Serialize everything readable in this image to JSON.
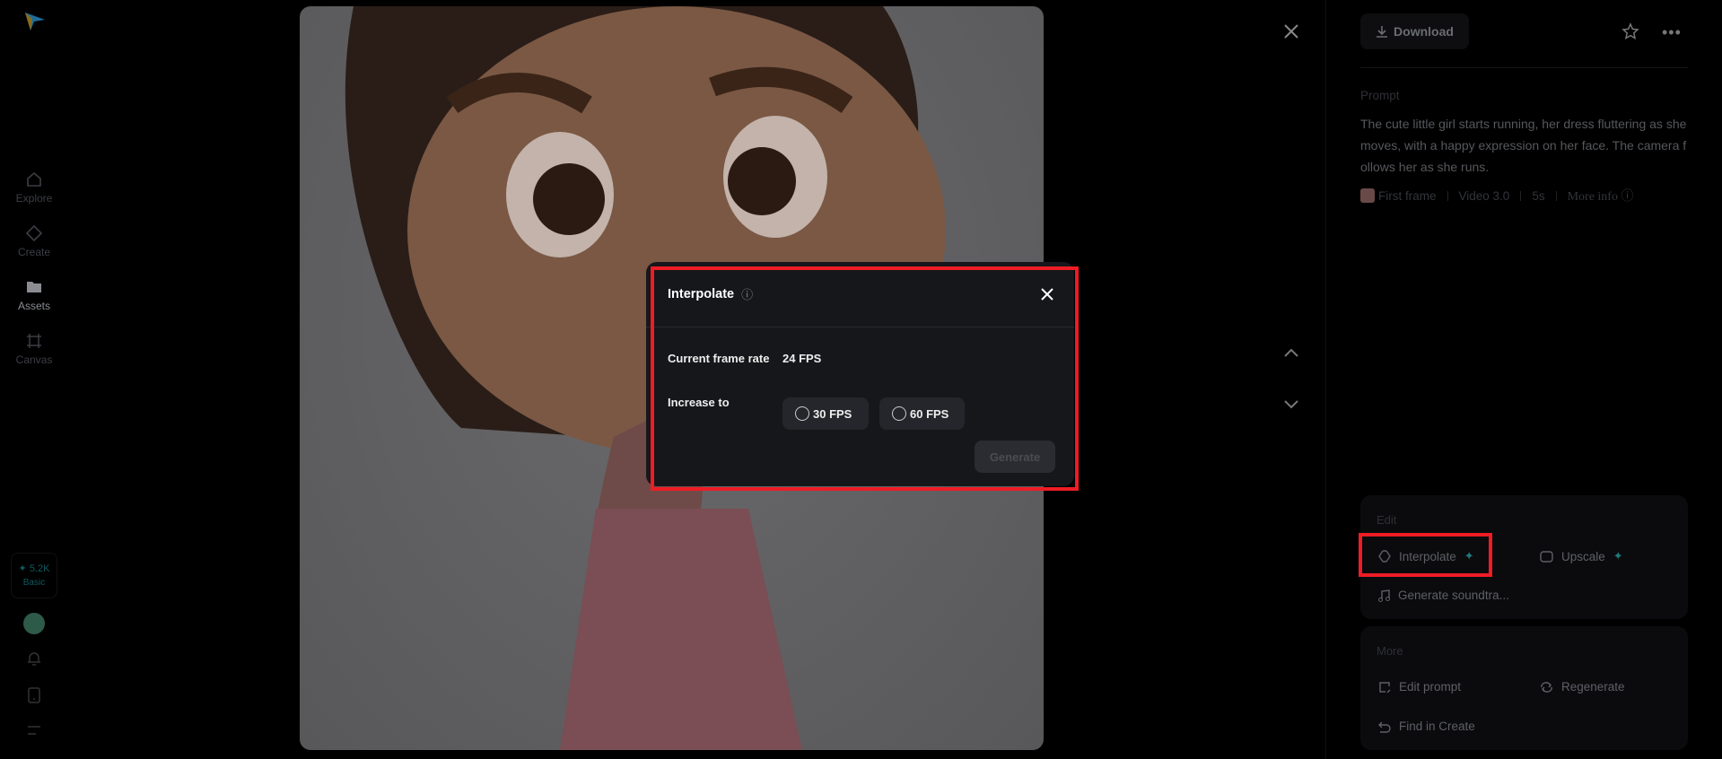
{
  "sidebar": {
    "items": [
      {
        "label": "Explore",
        "icon": "home-icon"
      },
      {
        "label": "Create",
        "icon": "diamond-icon"
      },
      {
        "label": "Assets",
        "icon": "folder-icon",
        "active": true
      },
      {
        "label": "Canvas",
        "icon": "crop-icon"
      }
    ],
    "credits": {
      "amount": "5.2K",
      "plan": "Basic"
    }
  },
  "header": {
    "download_label": "Download"
  },
  "prompt": {
    "label": "Prompt",
    "text": "The cute little girl starts running, her dress fluttering as she moves, with a happy expression on her face. The camera follows her as she runs.",
    "meta": {
      "reference": "First frame",
      "model": "Video 3.0",
      "duration": "5s",
      "more_info": "More info"
    }
  },
  "edit": {
    "label": "Edit",
    "interpolate": "Interpolate",
    "upscale": "Upscale",
    "soundtrack": "Generate soundtra..."
  },
  "more": {
    "label": "More",
    "edit_prompt": "Edit prompt",
    "regenerate": "Regenerate",
    "find_in_create": "Find in Create"
  },
  "dialog": {
    "title": "Interpolate",
    "current_label": "Current frame rate",
    "current_value": "24 FPS",
    "increase_label": "Increase to",
    "options": [
      "30 FPS",
      "60 FPS"
    ],
    "generate_label": "Generate"
  },
  "colors": {
    "accent": "#1f7a7d",
    "highlight": "#ee1c25"
  }
}
